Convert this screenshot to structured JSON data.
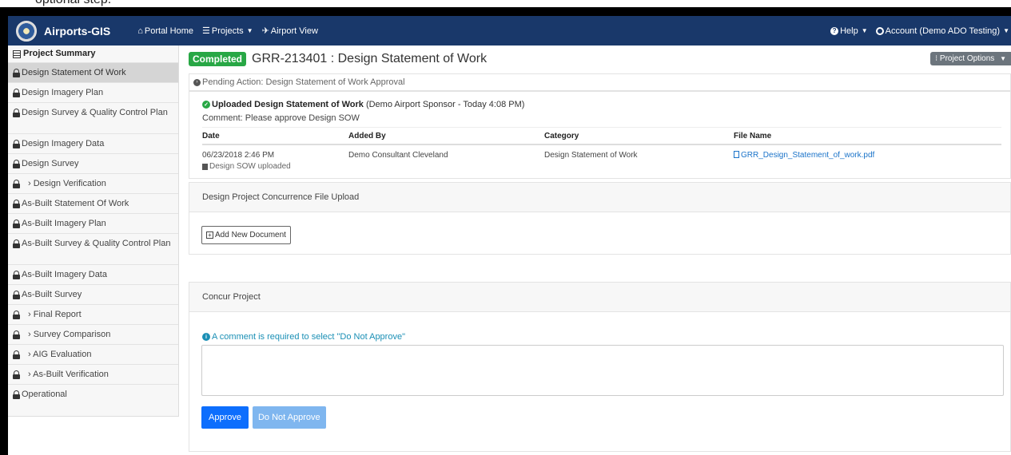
{
  "caption": "optional step.",
  "navbar": {
    "brand": "Airports-GIS",
    "links": [
      {
        "label": "Portal Home"
      },
      {
        "label": "Projects"
      },
      {
        "label": "Airport View"
      }
    ],
    "help": "Help",
    "account": "Account (Demo ADO Testing)"
  },
  "sidebar": {
    "header": "Project Summary",
    "items": [
      {
        "label": "Design Statement Of Work"
      },
      {
        "label": "Design Imagery Plan"
      },
      {
        "label": "Design Survey & Quality Control Plan"
      },
      {
        "label": "Design Imagery Data"
      },
      {
        "label": "Design Survey"
      },
      {
        "label": "› Design Verification"
      },
      {
        "label": "As-Built Statement Of Work"
      },
      {
        "label": "As-Built Imagery Plan"
      },
      {
        "label": "As-Built Survey & Quality Control Plan"
      },
      {
        "label": "As-Built Imagery Data"
      },
      {
        "label": "As-Built Survey"
      },
      {
        "label": "› Final Report"
      },
      {
        "label": "› Survey Comparison"
      },
      {
        "label": "› AIG Evaluation"
      },
      {
        "label": "› As-Built Verification"
      },
      {
        "label": "Operational"
      }
    ]
  },
  "main": {
    "status_badge": "Completed",
    "title": "GRR-213401 : Design Statement of Work",
    "project_options": "Project Options",
    "pending_action": "Pending Action: Design Statement of Work Approval",
    "upload": {
      "title": "Uploaded Design Statement of Work",
      "meta": "(Demo Airport Sponsor - Today 4:08 PM)",
      "comment": "Comment: Please approve Design SOW",
      "columns": [
        "Date",
        "Added By",
        "Category",
        "File Name"
      ],
      "row": {
        "date": "06/23/2018 2:46 PM",
        "added_by": "Demo Consultant Cleveland",
        "category": "Design Statement of Work",
        "file_name": "GRR_Design_Statement_of_work.pdf"
      },
      "note": "Design SOW uploaded"
    },
    "concurrence_upload": {
      "heading": "Design Project Concurrence File Upload",
      "add_button": "Add New Document"
    },
    "concur": {
      "heading": "Concur Project",
      "info": "A comment is required to select \"Do Not Approve\"",
      "comment_value": "",
      "approve": "Approve",
      "do_not_approve": "Do Not Approve"
    }
  },
  "colors": {
    "navbar": "#19386a",
    "success": "#28a745",
    "primary": "#0d6efd",
    "info": "#1a8fb5"
  }
}
